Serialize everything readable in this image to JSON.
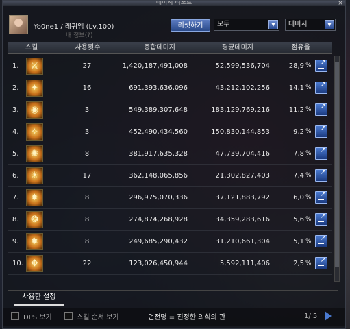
{
  "window": {
    "title": "데미지 리포트",
    "close_glyph": "×"
  },
  "player": {
    "name": "Yo0ne1 / 레퀴엠 (Lv.100)",
    "sub": "내 정보(?)"
  },
  "controls": {
    "reset_label": "리셋하기",
    "filter_value": "모두",
    "metric_value": "데미지"
  },
  "table": {
    "headers": [
      "스킬",
      "사용횟수",
      "총합데미지",
      "평균데미지",
      "점유율"
    ],
    "rows": [
      {
        "idx": "1.",
        "glyph": "⚔",
        "uses": "27",
        "total": "1,420,187,491,008",
        "avg": "52,599,536,704",
        "pct": "28,9",
        "pct_sym": "%"
      },
      {
        "idx": "2.",
        "glyph": "✦",
        "uses": "16",
        "total": "691,393,636,096",
        "avg": "43,212,102,256",
        "pct": "14,1",
        "pct_sym": "%"
      },
      {
        "idx": "3.",
        "glyph": "◉",
        "uses": "3",
        "total": "549,389,307,648",
        "avg": "183,129,769,216",
        "pct": "11,2",
        "pct_sym": "%"
      },
      {
        "idx": "4.",
        "glyph": "✧",
        "uses": "3",
        "total": "452,490,434,560",
        "avg": "150,830,144,853",
        "pct": "9,2",
        "pct_sym": "%"
      },
      {
        "idx": "5.",
        "glyph": "✺",
        "uses": "8",
        "total": "381,917,635,328",
        "avg": "47,739,704,416",
        "pct": "7,8",
        "pct_sym": "%"
      },
      {
        "idx": "6.",
        "glyph": "☀",
        "uses": "17",
        "total": "362,148,065,856",
        "avg": "21,302,827,403",
        "pct": "7,4",
        "pct_sym": "%"
      },
      {
        "idx": "7.",
        "glyph": "✸",
        "uses": "8",
        "total": "296,975,070,336",
        "avg": "37,121,883,792",
        "pct": "6,0",
        "pct_sym": "%"
      },
      {
        "idx": "8.",
        "glyph": "❂",
        "uses": "8",
        "total": "274,874,268,928",
        "avg": "34,359,283,616",
        "pct": "5,6",
        "pct_sym": "%"
      },
      {
        "idx": "9.",
        "glyph": "✹",
        "uses": "8",
        "total": "249,685,290,432",
        "avg": "31,210,661,304",
        "pct": "5,1",
        "pct_sym": "%"
      },
      {
        "idx": "10.",
        "glyph": "✥",
        "uses": "22",
        "total": "123,026,450,944",
        "avg": "5,592,111,406",
        "pct": "2,5",
        "pct_sym": "%"
      }
    ]
  },
  "tabs": {
    "settings": "사용한 설정"
  },
  "footer": {
    "dps_label": "DPS 보기",
    "skill_order_label": "스킬 순서 보기",
    "dungeon": "던전명 = 진정한 의식의 관",
    "page": "1/ 5"
  }
}
